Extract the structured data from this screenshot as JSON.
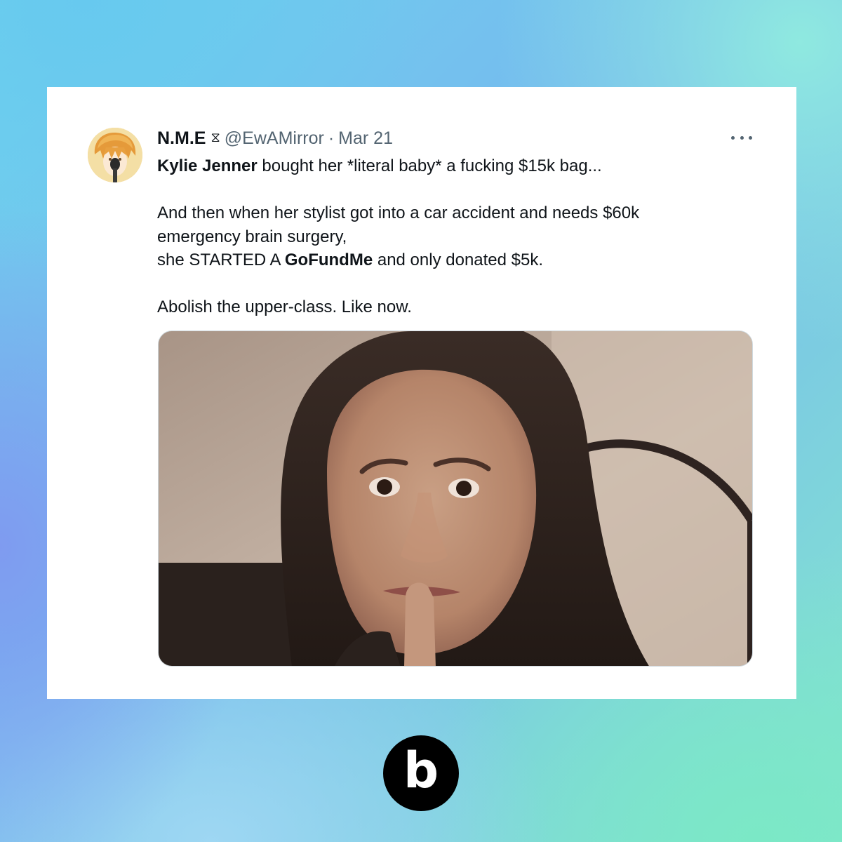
{
  "tweet": {
    "author": {
      "display_name": "N.M.E",
      "badge_glyph": "⧖",
      "handle": "@EwAMirror",
      "separator": "·",
      "date": "Mar 21",
      "avatar_icon": "anime-avatar-icon"
    },
    "more_icon": "more-options-icon",
    "body": {
      "line1_bold": "Kylie Jenner",
      "line1_rest": " bought her *literal baby* a fucking $15k bag...",
      "line2": "And then when her stylist got into a car accident and needs $60k",
      "line3": "emergency brain surgery,",
      "line4_start": "she STARTED A ",
      "line4_bold": "GoFundMe",
      "line4_end": " and only donated $5k.",
      "line5": "Abolish the upper-class. Like now."
    },
    "media_icon": "photo-woman-finger-on-lips"
  },
  "brand": {
    "logo_letter": "b",
    "logo_icon": "b-logo-icon"
  },
  "colors": {
    "text_primary": "#0f1419",
    "text_secondary": "#536471",
    "card_background": "#ffffff",
    "logo_background": "#000000"
  }
}
